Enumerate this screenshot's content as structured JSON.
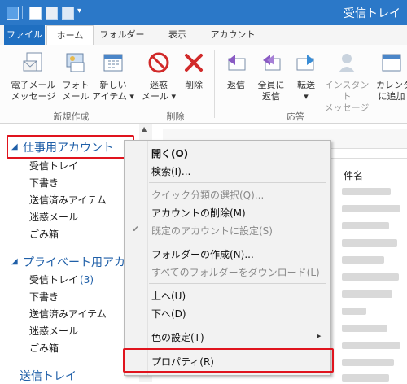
{
  "window": {
    "title": "受信トレイ"
  },
  "tabs": [
    "ファイル",
    "ホーム",
    "フォルダー",
    "表示",
    "アカウント"
  ],
  "ribbon": {
    "buttons": [
      {
        "line1": "電子メール",
        "line2": "メッセージ",
        "icon": "mail-icon"
      },
      {
        "line1": "フォト",
        "line2": "メール",
        "icon": "photo-mail-icon"
      },
      {
        "line1": "新しい",
        "line2": "アイテム ▾",
        "icon": "calendar-icon"
      },
      {
        "line1": "迷惑",
        "line2": "メール ▾",
        "icon": "block-icon"
      },
      {
        "line1": "削除",
        "line2": "",
        "icon": "delete-x-icon"
      },
      {
        "line1": "返信",
        "line2": "",
        "icon": "reply-icon"
      },
      {
        "line1": "全員に",
        "line2": "返信",
        "icon": "reply-all-icon"
      },
      {
        "line1": "転送",
        "line2": "▾",
        "icon": "forward-icon"
      },
      {
        "line1": "インスタント",
        "line2": "メッセージ",
        "icon": "im-icon"
      },
      {
        "line1": "カレンダ",
        "line2": "に追加",
        "icon": "calendar-add-icon"
      }
    ],
    "groups": [
      "新規作成",
      "削除",
      "応答"
    ]
  },
  "nav": {
    "account1": "仕事用アカウント",
    "account1_folders": [
      "受信トレイ",
      "下書き",
      "送信済みアイテム",
      "迷惑メール",
      "ごみ箱"
    ],
    "account2": "プライベート用アカウン",
    "account2_folders": [
      "受信トレイ",
      "下書き",
      "送信済みアイテム",
      "迷惑メール",
      "ごみ箱"
    ],
    "inbox_count": "(3)",
    "bottom": "送信トレイ"
  },
  "list": {
    "header_subject": "件名"
  },
  "context_menu": {
    "items": [
      "開く(O)",
      "検索(I)...",
      "クイック分類の選択(Q)...",
      "アカウントの削除(M)",
      "既定のアカウントに設定(S)",
      "フォルダーの作成(N)...",
      "すべてのフォルダーをダウンロード(L)",
      "上へ(U)",
      "下へ(D)",
      "色の設定(T)",
      "プロパティ(R)"
    ],
    "check_mark": "✔",
    "submenu_arrow": "▶"
  },
  "colors": {
    "title_bar": "#2b78c8",
    "highlight": "#e0141e",
    "link": "#1f5fa8"
  }
}
